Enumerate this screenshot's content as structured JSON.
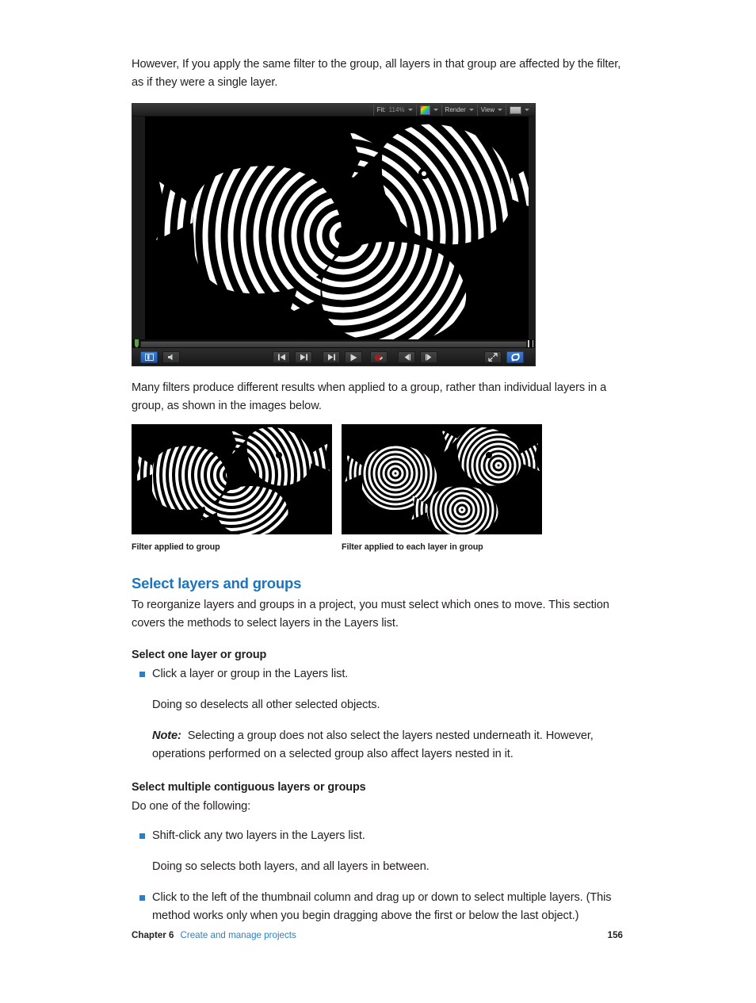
{
  "page": {
    "intro_paragraph": "However, If you apply the same filter to the group, all layers in that group are affected by the filter, as if they were a single layer.",
    "second_paragraph": "Many filters produce different results when applied to a group, rather than individual layers in a group, as shown in the images below."
  },
  "viewer": {
    "zoom_label": "Fit:",
    "zoom_value": "114%",
    "render_label": "Render",
    "view_label": "View",
    "color_swatch_icon": "color-channels-icon",
    "display_swatch_icon": "display-mode-icon",
    "canvas_description": "Three fish shapes rendered in black and white with a concentric ring contour filter applied across the whole group",
    "transport": {
      "panel_toggle": "toggle-panel-icon",
      "audio": "speaker-icon",
      "go_to_start": "go-to-start-icon",
      "go_to_end": "go-to-end-icon",
      "play_from_start": "play-from-start-icon",
      "play": "play-icon",
      "record": "record-icon",
      "step_back": "step-backward-icon",
      "step_forward": "step-forward-icon",
      "fullscreen": "fullscreen-icon",
      "loop": "loop-icon"
    }
  },
  "figures": [
    {
      "caption": "Filter applied to group",
      "description": "Three fish sharing a single set of concentric rings centered between them"
    },
    {
      "caption": "Filter applied to each layer in group",
      "description": "Three fish each with their own independent set of concentric rings"
    }
  ],
  "section": {
    "heading": "Select layers and groups",
    "intro": "To reorganize layers and groups in a project, you must select which ones to move. This section covers the methods to select layers in the Layers list.",
    "subsections": [
      {
        "heading": "Select one layer or group",
        "bullets": [
          "Click a layer or group in the Layers list."
        ],
        "follow_up": "Doing so deselects all other selected objects.",
        "note_label": "Note:",
        "note_text": "Selecting a group does not also select the layers nested underneath it. However, operations performed on a selected group also affect layers nested in it."
      },
      {
        "heading": "Select multiple contiguous layers or groups",
        "lead_in": "Do one of the following:",
        "bullet_one": "Shift-click any two layers in the Layers list.",
        "follow_up": "Doing so selects both layers, and all layers in between.",
        "bullet_two": "Click to the left of the thumbnail column and drag up or down to select multiple layers. (This method works only when you begin dragging above the first or below the last object.)"
      }
    ]
  },
  "footer": {
    "chapter": "Chapter 6",
    "chapter_title": "Create and manage projects",
    "page_number": "156"
  },
  "colors": {
    "heading_blue": "#1b74bd",
    "link_blue": "#2b7fc4",
    "bullet_blue": "#2b7fc4",
    "body_text": "#231f20"
  }
}
